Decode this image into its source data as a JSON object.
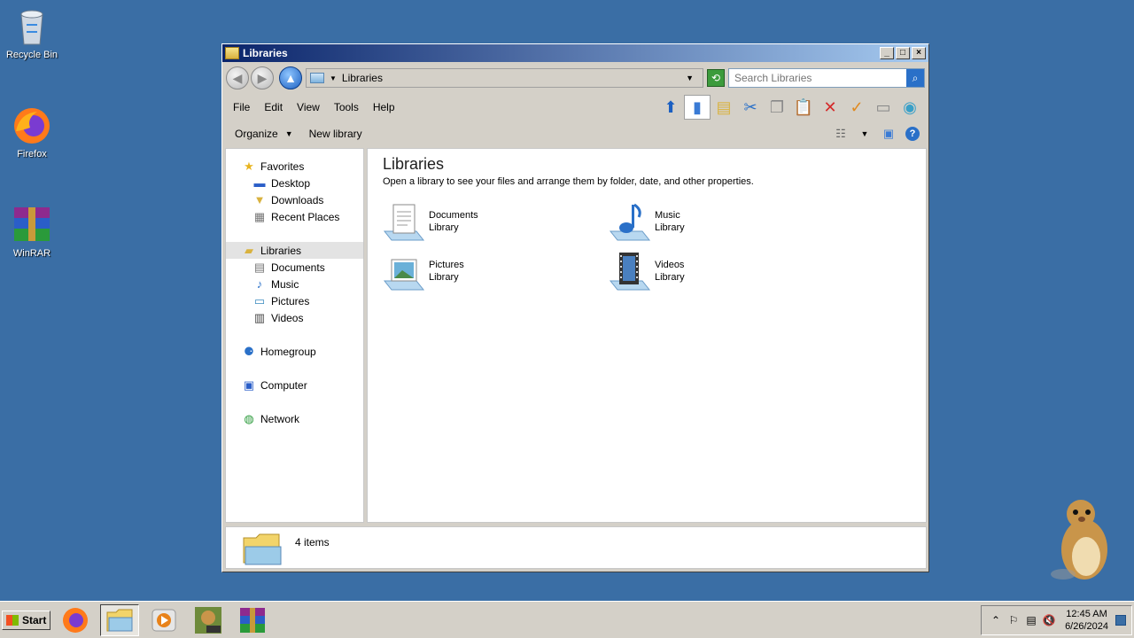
{
  "desktop": {
    "icons": [
      {
        "label": "Recycle Bin",
        "icon": "recycle-bin-icon"
      },
      {
        "label": "Firefox",
        "icon": "firefox-icon"
      },
      {
        "label": "WinRAR",
        "icon": "winrar-icon"
      }
    ]
  },
  "window": {
    "title": "Libraries",
    "address": {
      "crumb": "Libraries"
    },
    "search": {
      "placeholder": "Search Libraries"
    },
    "menu": [
      "File",
      "Edit",
      "View",
      "Tools",
      "Help"
    ],
    "commands": {
      "organize": "Organize",
      "new_library": "New library"
    },
    "nav": {
      "favorites": "Favorites",
      "favorites_items": [
        "Desktop",
        "Downloads",
        "Recent Places"
      ],
      "libraries": "Libraries",
      "libraries_items": [
        "Documents",
        "Music",
        "Pictures",
        "Videos"
      ],
      "homegroup": "Homegroup",
      "computer": "Computer",
      "network": "Network"
    },
    "content": {
      "heading": "Libraries",
      "subtitle": "Open a library to see your files and arrange them by folder, date, and other properties.",
      "libraries": [
        {
          "name": "Documents",
          "type": "Library"
        },
        {
          "name": "Music",
          "type": "Library"
        },
        {
          "name": "Pictures",
          "type": "Library"
        },
        {
          "name": "Videos",
          "type": "Library"
        }
      ]
    },
    "status": {
      "count": "4 items"
    }
  },
  "taskbar": {
    "start": "Start",
    "clock_time": "12:45 AM",
    "clock_date": "6/26/2024"
  }
}
